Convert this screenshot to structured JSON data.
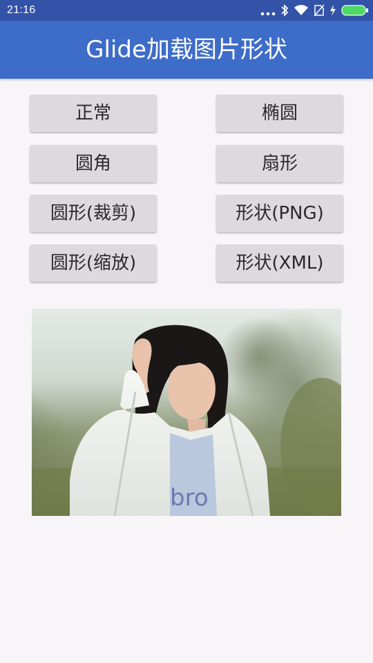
{
  "status_bar": {
    "time": "21:16",
    "icons": [
      "more-dots-icon",
      "bluetooth-icon",
      "wifi-icon",
      "no-sim-icon",
      "charging-icon",
      "battery-icon"
    ]
  },
  "app_bar": {
    "title": "Glide加载图片形状"
  },
  "buttons": {
    "normal": "正常",
    "ellipse": "椭圆",
    "rounded_corner": "圆角",
    "sector": "扇形",
    "circle_crop": "圆形(裁剪)",
    "shape_png": "形状(PNG)",
    "circle_scale": "圆形(缩放)",
    "shape_xml": "形状(XML)"
  },
  "image": {
    "subject": "girl in white jacket outdoors"
  },
  "colors": {
    "status_bar": "#3353a8",
    "app_bar": "#3e6cc9",
    "background": "#f7f5f7",
    "button": "#dcdadc",
    "battery": "#4cd964"
  }
}
